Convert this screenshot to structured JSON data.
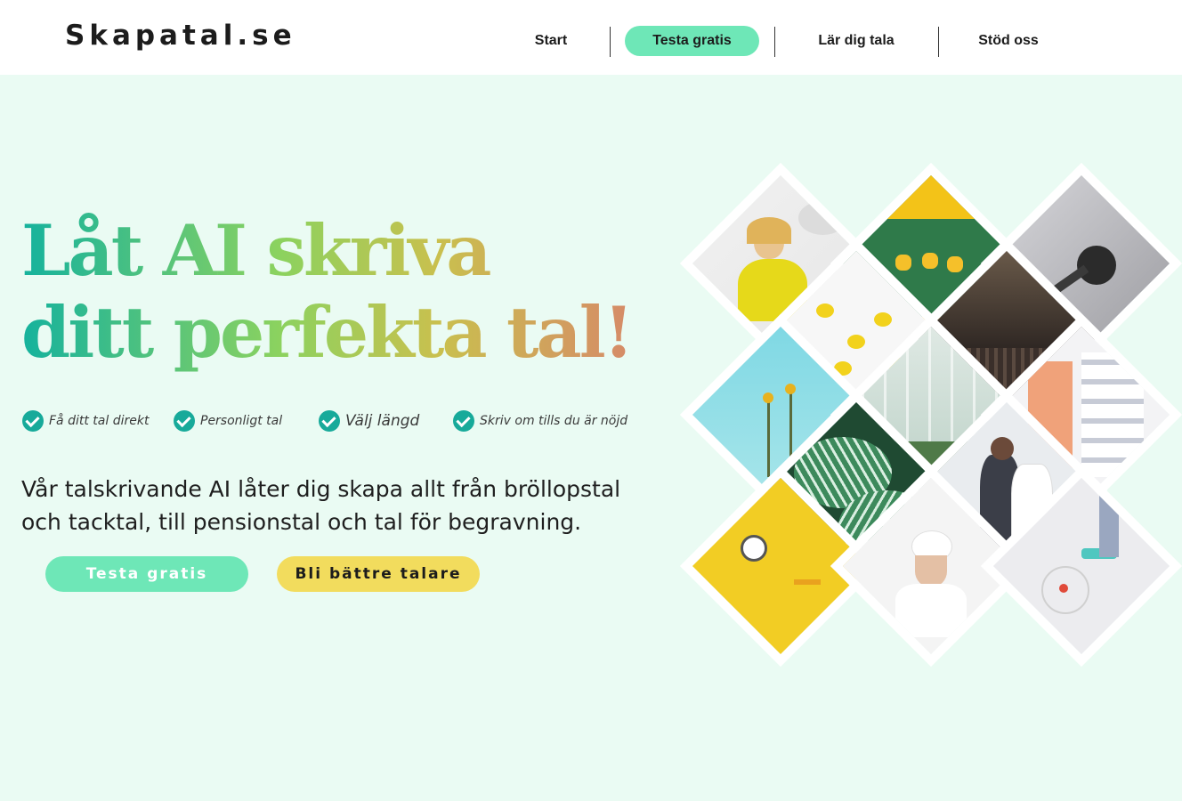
{
  "header": {
    "logo": "Skapatal.se",
    "nav": [
      {
        "label": "Start"
      },
      {
        "label": "Testa gratis"
      },
      {
        "label": "Lär dig tala"
      },
      {
        "label": "Stöd oss"
      }
    ]
  },
  "hero": {
    "headline_line1": "Låt AI skriva",
    "headline_line2": "ditt perfekta tal!",
    "features": [
      {
        "label": "Få ditt tal direkt"
      },
      {
        "label": "Personligt tal"
      },
      {
        "label": "Välj längd"
      },
      {
        "label": "Skriv om tills du är nöjd"
      }
    ],
    "description": "Vår talskrivande AI låter dig skapa allt från bröllopstal och tacktal, till pensionstal och tal för begravning.",
    "buttons": {
      "primary": "Testa gratis",
      "secondary": "Bli bättre talare"
    }
  },
  "colors": {
    "accent_green": "#6ee7b7",
    "accent_yellow": "#f2dc5d",
    "background": "#eafbf3",
    "check_teal": "#17aa9a"
  }
}
